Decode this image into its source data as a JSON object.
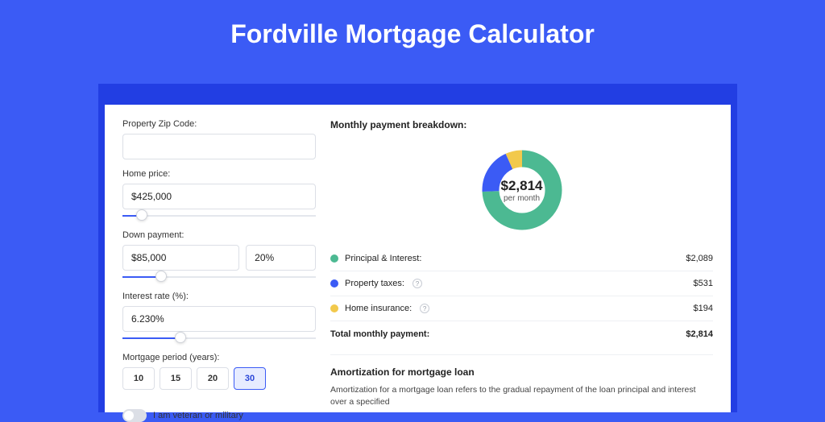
{
  "hero_title": "Fordville Mortgage Calculator",
  "form": {
    "zip_label": "Property Zip Code:",
    "zip_value": "",
    "price_label": "Home price:",
    "price_value": "$425,000",
    "price_slider_pct": 10,
    "down_label": "Down payment:",
    "down_value": "$85,000",
    "down_pct_value": "20%",
    "down_slider_pct": 20,
    "rate_label": "Interest rate (%):",
    "rate_value": "6.230%",
    "rate_slider_pct": 30,
    "period_label": "Mortgage period (years):",
    "periods": [
      "10",
      "15",
      "20",
      "30"
    ],
    "period_active_index": 3,
    "veteran_label": "I am veteran or military"
  },
  "breakdown": {
    "title": "Monthly payment breakdown:",
    "center_amount": "$2,814",
    "center_sub": "per month",
    "items": [
      {
        "label": "Principal & Interest:",
        "value": "$2,089",
        "color": "#4CB992",
        "has_info": false,
        "pct": 74.2
      },
      {
        "label": "Property taxes:",
        "value": "$531",
        "color": "#3B5BF5",
        "has_info": true,
        "pct": 18.9
      },
      {
        "label": "Home insurance:",
        "value": "$194",
        "color": "#F2C94C",
        "has_info": true,
        "pct": 6.9
      }
    ],
    "total_label": "Total monthly payment:",
    "total_value": "$2,814"
  },
  "amort": {
    "title": "Amortization for mortgage loan",
    "p1": "Amortization for a mortgage loan refers to the gradual repayment of the loan principal and interest over a specified"
  },
  "chart_data": {
    "type": "pie",
    "title": "Monthly payment breakdown",
    "series": [
      {
        "name": "Principal & Interest",
        "value": 2089,
        "color": "#4CB992"
      },
      {
        "name": "Property taxes",
        "value": 531,
        "color": "#3B5BF5"
      },
      {
        "name": "Home insurance",
        "value": 194,
        "color": "#F2C94C"
      }
    ],
    "total": 2814,
    "total_label": "per month"
  }
}
